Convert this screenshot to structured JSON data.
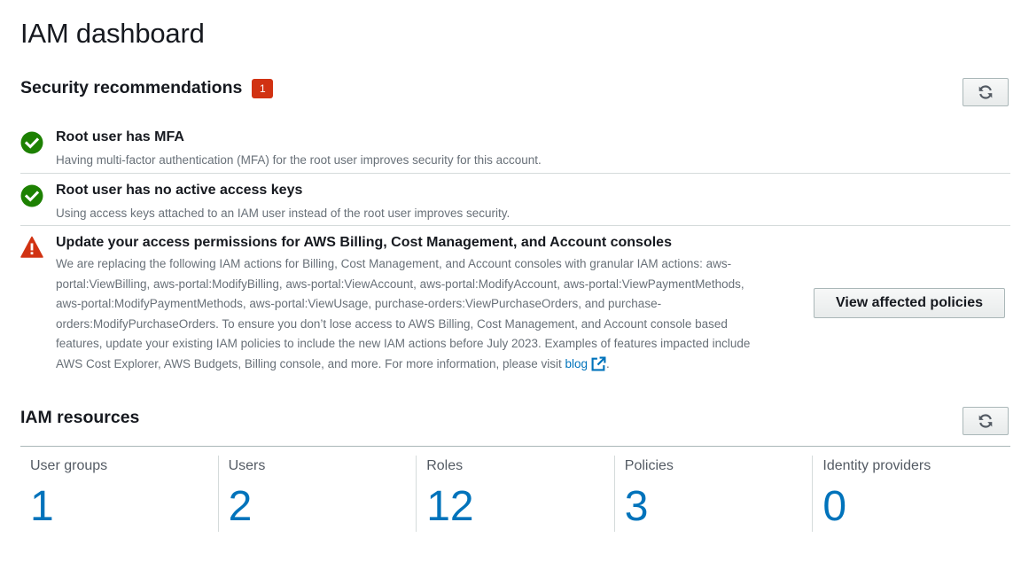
{
  "page": {
    "title": "IAM dashboard"
  },
  "security": {
    "title": "Security recommendations",
    "badge_count": "1",
    "items": [
      {
        "status": "success",
        "icon": "check-circle-icon",
        "title": "Root user has MFA",
        "description": "Having multi-factor authentication (MFA) for the root user improves security for this account."
      },
      {
        "status": "success",
        "icon": "check-circle-icon",
        "title": "Root user has no active access keys",
        "description": "Using access keys attached to an IAM user instead of the root user improves security."
      },
      {
        "status": "warning",
        "icon": "warning-triangle-icon",
        "title": "Update your access permissions for AWS Billing, Cost Management, and Account consoles",
        "description": "We are replacing the following IAM actions for Billing, Cost Management, and Account consoles with granular IAM actions: aws-portal:ViewBilling, aws-portal:ModifyBilling, aws-portal:ViewAccount, aws-portal:ModifyAccount, aws-portal:ViewPaymentMethods, aws-portal:ModifyPaymentMethods, aws-portal:ViewUsage, purchase-orders:ViewPurchaseOrders, and purchase-orders:ModifyPurchaseOrders. To ensure you don’t lose access to AWS Billing, Cost Management, and Account console based features, update your existing IAM policies to include the new IAM actions before July 2023. Examples of features impacted include AWS Cost Explorer, AWS Budgets, Billing console, and more. For more information, please visit",
        "link_text": "blog",
        "link_suffix": ".",
        "action_label": "View affected policies"
      }
    ]
  },
  "resources": {
    "title": "IAM resources",
    "items": [
      {
        "label": "User groups",
        "count": "1"
      },
      {
        "label": "Users",
        "count": "2"
      },
      {
        "label": "Roles",
        "count": "12"
      },
      {
        "label": "Policies",
        "count": "3"
      },
      {
        "label": "Identity providers",
        "count": "0"
      }
    ]
  },
  "colors": {
    "success": "#1d8102",
    "warning": "#d13212",
    "link": "#0073bb",
    "badge": "#d13212"
  },
  "icons": {
    "refresh": "refresh-icon",
    "external_link": "external-link-icon"
  }
}
